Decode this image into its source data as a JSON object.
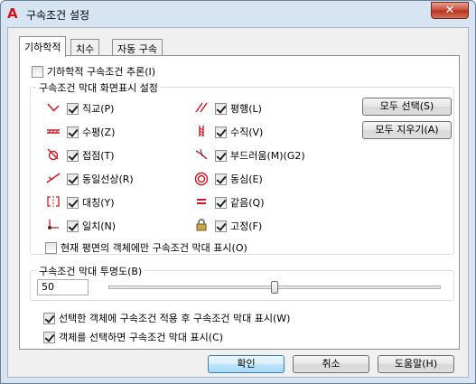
{
  "window": {
    "title": "구속조건 설정",
    "close_symbol": "✕"
  },
  "tabs": [
    {
      "label": "기하학적",
      "active": true
    },
    {
      "label": "치수",
      "active": false
    },
    {
      "label": "자동 구속",
      "active": false
    }
  ],
  "infer": {
    "label": "기하학적 구속조건 추론(I)",
    "checked": false
  },
  "display_group": {
    "title": "구속조건 막대 화면표시 설정",
    "left_items": [
      {
        "label": "직교(P)",
        "icon": "perpendicular-icon",
        "checked": true
      },
      {
        "label": "수평(Z)",
        "icon": "horizontal-icon",
        "checked": true
      },
      {
        "label": "접점(T)",
        "icon": "tangent-icon",
        "checked": true
      },
      {
        "label": "동일선상(R)",
        "icon": "collinear-icon",
        "checked": true
      },
      {
        "label": "대칭(Y)",
        "icon": "symmetric-icon",
        "checked": true
      },
      {
        "label": "일치(N)",
        "icon": "coincident-icon",
        "checked": true
      }
    ],
    "right_items": [
      {
        "label": "평행(L)",
        "icon": "parallel-icon",
        "checked": true
      },
      {
        "label": "수직(V)",
        "icon": "vertical-icon",
        "checked": true
      },
      {
        "label": "부드러움(M)(G2)",
        "icon": "smooth-icon",
        "checked": true
      },
      {
        "label": "동심(E)",
        "icon": "concentric-icon",
        "checked": true
      },
      {
        "label": "같음(Q)",
        "icon": "equal-icon",
        "checked": true
      },
      {
        "label": "고정(F)",
        "icon": "lock-icon",
        "checked": true
      }
    ],
    "select_all_label": "모두 선택(S)",
    "clear_all_label": "모두 지우기(A)",
    "current_plane_only": {
      "label": "현재 평면의 객체에만 구속조건 막대 표시(O)",
      "checked": false
    }
  },
  "transparency": {
    "title": "구속조건 막대 투명도(B)",
    "value": "50",
    "slider_percent": 50
  },
  "show_after_apply": {
    "label": "선택한 객체에 구속조건 적용 후 구속조건 막대 표시(W)",
    "checked": true
  },
  "show_on_select": {
    "label": "객체를 선택하면 구속조건 막대 표시(C)",
    "checked": true
  },
  "buttons": {
    "ok": "확인",
    "cancel": "취소",
    "help": "도움말(H)"
  }
}
